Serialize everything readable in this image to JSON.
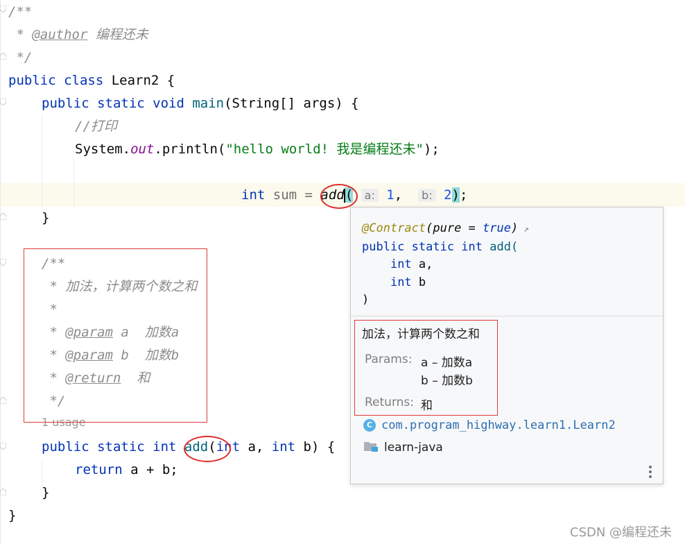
{
  "code": {
    "l1": "/**",
    "author_prefix": " * ",
    "author_tag": "@author",
    "author_name": " 编程还未",
    "l3": " */",
    "class_kw": "public class ",
    "class_rest": "Learn2 {",
    "main_kw": "public static void ",
    "main_name": "main",
    "main_rest": "(String[] args) {",
    "comment_print": "//打印",
    "sys": "System.",
    "sys_out": "out",
    "sys_rest": ".println(",
    "sys_str": "\"hello world! 我是编程还未\"",
    "sys_end": ");",
    "sum_kw": "int",
    "sum_name": " sum = ",
    "sum_call": "add",
    "sum_open": "(",
    "hint_a": "a:",
    "val_a": "1",
    "comma": ",  ",
    "hint_b": "b:",
    "val_b": "2",
    "sum_close": ")",
    "sum_end": ";",
    "close_main": "}",
    "doc_open": "/**",
    "doc_desc": " * 加法，计算两个数之和",
    "doc_star": " *",
    "doc_param_prefix": " * ",
    "doc_param_tag": "@param",
    "doc_param_a": " a  加数a",
    "doc_param_b": " b  加数b",
    "doc_return_tag": "@return",
    "doc_return_val": "  和",
    "doc_close": " */",
    "usage": "1 usage",
    "add_kw": "public static int ",
    "add_name": "add",
    "add_p1": "(",
    "add_int1": "int",
    "add_p2": " a, ",
    "add_int2": "int",
    "add_p3": " b) {",
    "ret_kw": "return",
    "ret_rest": " a + b;",
    "close_add": "}",
    "close_class": "}"
  },
  "popup": {
    "annotation": "@Contract",
    "annotation_args": "(pure = true)",
    "annotation_kw": "true",
    "sig_kw": "public static int ",
    "sig_name": "add(",
    "param1_kw": "int",
    "param1_rest": " a,",
    "param2_kw": "int",
    "param2_rest": " b",
    "sig_close": ")",
    "description": "加法，计算两个数之和",
    "params_label": "Params:",
    "param_a": "a – 加数a",
    "param_b": "b – 加数b",
    "returns_label": "Returns:",
    "returns_val": "和",
    "class_icon": "C",
    "class_path": "com.program_highway.learn1.Learn2",
    "module": "learn-java"
  },
  "watermark": "CSDN @编程还未",
  "colors": {
    "keyword": "#0033b3",
    "string": "#067d17",
    "comment": "#8c8c8c",
    "method": "#00627a",
    "number": "#1750eb",
    "highlight": "#e03a3a"
  }
}
